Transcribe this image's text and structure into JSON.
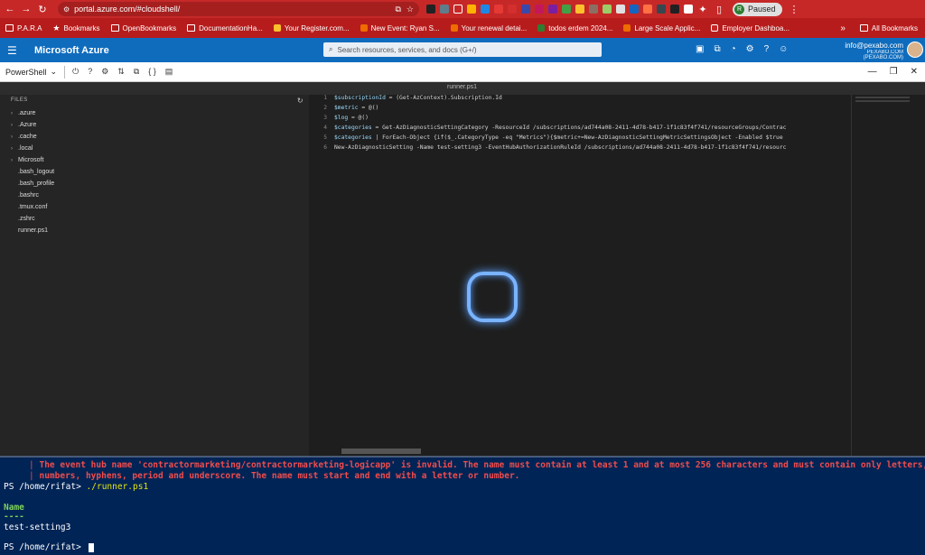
{
  "browser": {
    "url": "portal.azure.com/#cloudshell/",
    "profile_initial": "R",
    "profile_label": "Paused"
  },
  "bookmarks": {
    "items": [
      "P.A.R.A",
      "Bookmarks",
      "OpenBookmarks",
      "DocumentationHa...",
      "Your Register.com...",
      "New Event: Ryan S...",
      "Your renewal detai...",
      "todos erdem 2024...",
      "Large Scale Applic...",
      "Employer Dashboa..."
    ],
    "all_label": "All Bookmarks"
  },
  "azure": {
    "brand": "Microsoft Azure",
    "search_placeholder": "Search resources, services, and docs (G+/)",
    "account_email": "info@pexabo.com",
    "account_directory": "PEXABO.COM (PEXABO.COM)"
  },
  "shell": {
    "type": "PowerShell"
  },
  "editor": {
    "tab_title": "runner.ps1",
    "files_heading": "FILES",
    "folders": [
      ".azure",
      ".Azure",
      ".cache",
      ".local",
      "Microsoft"
    ],
    "files": [
      ".bash_logout",
      ".bash_profile",
      ".bashrc",
      ".tmux.conf",
      ".zshrc",
      "runner.ps1"
    ],
    "lines": [
      {
        "n": "1",
        "v": "$subscriptionId",
        "r": " = (Get-AzContext).Subscription.Id"
      },
      {
        "n": "2",
        "v": "$metric",
        "r": " = @()"
      },
      {
        "n": "3",
        "v": "$log",
        "r": " = @()"
      },
      {
        "n": "4",
        "v": "$categories",
        "r": " = Get-AzDiagnosticSettingCategory -ResourceId /subscriptions/ad744a08-2411-4d78-b417-1f1c83f4f741/resourceGroups/Contrac"
      },
      {
        "n": "5",
        "v": "$categories",
        "r": " | ForEach-Object {if($_.CategoryType -eq \"Metrics\"){$metric+=New-AzDiagnosticSettingMetricSettingsObject -Enabled $true"
      },
      {
        "n": "6",
        "v": "",
        "r": "New-AzDiagnosticSetting -Name test-setting3 -EventHubAuthorizationRuleId /subscriptions/ad744a08-2411-4d78-b417-1f1c83f4f741/resourc"
      }
    ]
  },
  "terminal": {
    "error_line1": "The event hub name 'contractormarketing/contractormarketing-logicapp' is invalid. The name must contain at least 1 and at most 256 characters and must contain only letters,",
    "error_line2": "numbers, hyphens, period and underscore. The name must start and end with a letter or number.",
    "prompt": "PS /home/rifat>",
    "command": "./runner.ps1",
    "header": "Name",
    "underline": "----",
    "value": "test-setting3"
  }
}
